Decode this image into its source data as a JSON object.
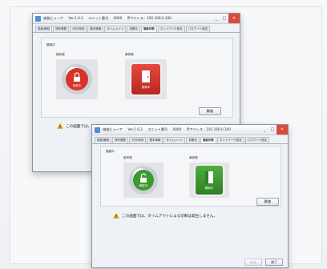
{
  "window_back": {
    "title_parts": [
      "施錠ビューア",
      "Ver.1.0.2",
      "ユニット番号",
      "0000",
      "IPアドレス：192.168.0.100"
    ],
    "tabs": [
      "施錠/解錠",
      "操作履歴",
      "日付/時刻",
      "基本情報",
      "タイムメイト",
      "初期化",
      "施錠状態",
      "ネットワーク設定",
      "パスワード設定"
    ],
    "active_tab_index": 6,
    "panel_label": "施錠中",
    "lock_label": "錠状態",
    "door_label": "扉状態",
    "lock_status": "施錠中",
    "door_status": "閉扉中",
    "unlock_button": "解錠",
    "note": "この画面では、タイムアウトによる切断は発生しません。",
    "lock_color": "#d8332b",
    "door_color": "#d8332b"
  },
  "window_front": {
    "title_parts": [
      "施錠ビューア",
      "Ver.1.0.2",
      "ユニット番号",
      "0000",
      "IPアドレス：192.168.0.100"
    ],
    "tabs": [
      "施錠/解錠",
      "操作履歴",
      "日付/時刻",
      "基本情報",
      "タイムメイト",
      "初期化",
      "施錠状態",
      "ネットワーク設定",
      "パスワード設定"
    ],
    "active_tab_index": 6,
    "panel_label": "施錠中",
    "lock_label": "錠状態",
    "door_label": "扉状態",
    "lock_status": "解錠中",
    "door_status": "開扉中",
    "unlock_button": "解錠",
    "note": "この画面では、タイムアウトによる切断は発生しません。",
    "footer_buttons": [
      "戻る",
      "終了"
    ],
    "lock_color": "#3b9a32",
    "door_color": "#3b9a32"
  }
}
